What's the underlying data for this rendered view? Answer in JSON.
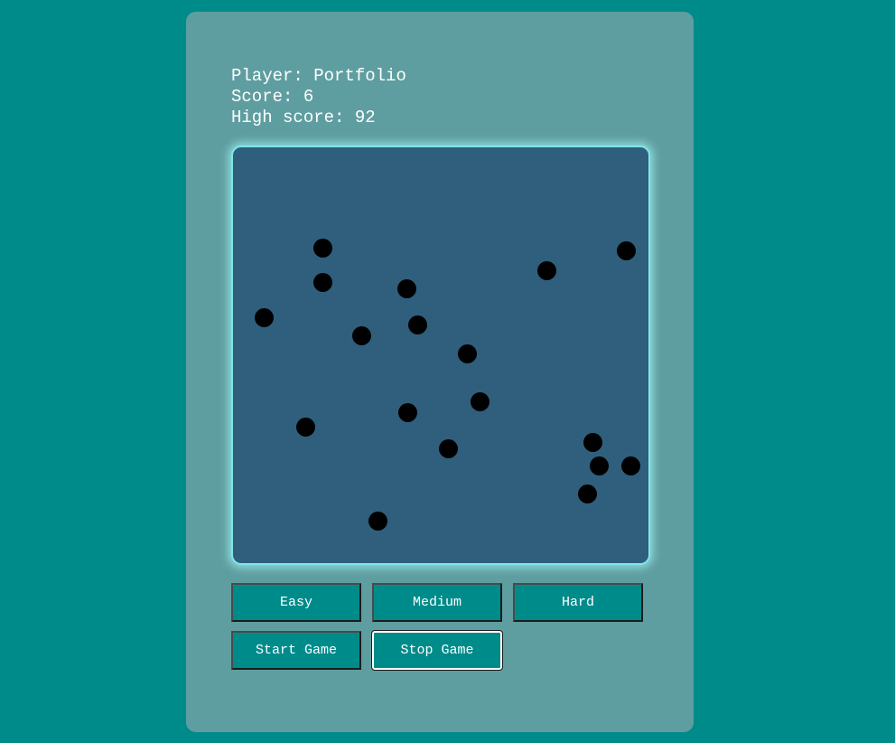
{
  "player": {
    "label": "Player:",
    "name": "Portfolio"
  },
  "score": {
    "label": "Score:",
    "value": "6"
  },
  "high_score": {
    "label": "High score:",
    "value": "92"
  },
  "buttons": {
    "easy": "Easy",
    "medium": "Medium",
    "hard": "Hard",
    "start": "Start Game",
    "stop": "Stop Game"
  },
  "colors": {
    "background": "#008b8b",
    "panel": "#5f9ea0",
    "board": "#2f5f7c",
    "board_glow": "#7fe6ea",
    "ball": "#000000"
  }
}
